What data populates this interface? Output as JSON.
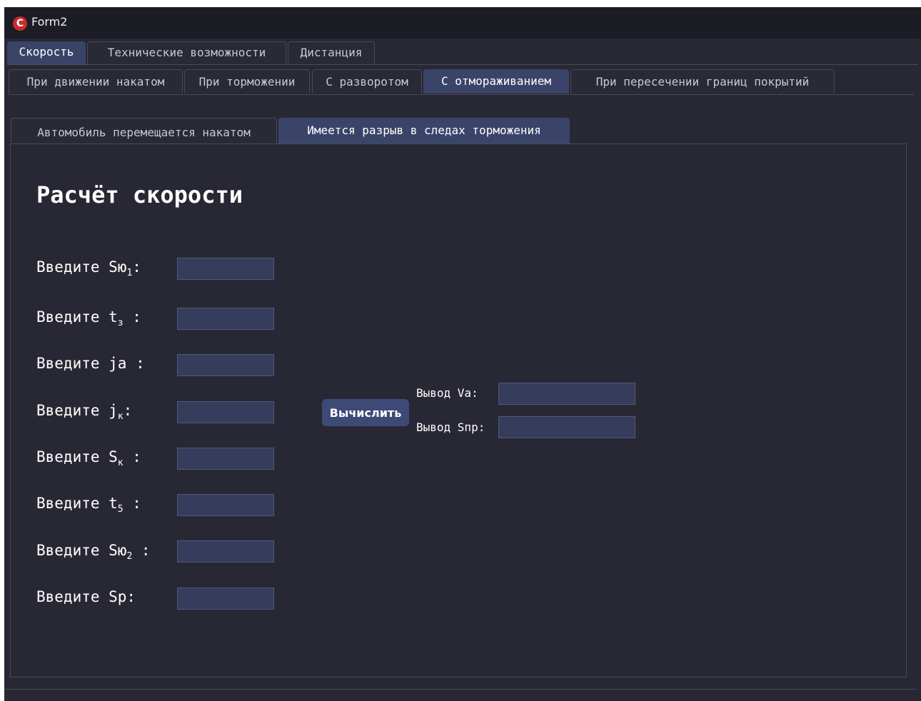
{
  "window": {
    "title": "Form2",
    "icon": "app-logo-icon"
  },
  "main_tabs": [
    {
      "label": "Скорость",
      "active": true
    },
    {
      "label": "Технические возможности",
      "active": false
    },
    {
      "label": "Дистанция",
      "active": false
    }
  ],
  "sub_tabs": [
    {
      "label": "При движении накатом",
      "active": false
    },
    {
      "label": "При торможении",
      "active": false
    },
    {
      "label": "С разворотом",
      "active": false
    },
    {
      "label": "С отмораживанием",
      "active": true
    },
    {
      "label": "При пересечении границ покрытий",
      "active": false
    }
  ],
  "inner_tabs": [
    {
      "label": "Автомобиль перемещается накатом",
      "active": false
    },
    {
      "label": "Имеется разрыв в следах торможения",
      "active": true
    }
  ],
  "content": {
    "heading": "Расчёт скорости",
    "fields": [
      {
        "prefix": "Введите Sю",
        "sub": "1",
        "suffix": ":",
        "value": ""
      },
      {
        "prefix": "Введите t",
        "sub": "з",
        "suffix": " :",
        "value": ""
      },
      {
        "prefix": "Введите jа",
        "sub": "",
        "suffix": " :",
        "value": ""
      },
      {
        "prefix": "Введите j",
        "sub": "к",
        "suffix": ":",
        "value": ""
      },
      {
        "prefix": "Введите S",
        "sub": "к",
        "suffix": " :",
        "value": ""
      },
      {
        "prefix": "Введите t",
        "sub": "5",
        "suffix": " :",
        "value": ""
      },
      {
        "prefix": "Введите Sю",
        "sub": "2",
        "suffix": " :",
        "value": ""
      },
      {
        "prefix": "Введите Sр:",
        "sub": "",
        "suffix": "",
        "value": ""
      }
    ],
    "calculate_label": "Вычислить",
    "outputs": [
      {
        "label": "Вывод Va:",
        "value": ""
      },
      {
        "label": "Вывод Sпр:",
        "value": ""
      }
    ]
  },
  "colors": {
    "background": "#282834",
    "titlebar": "#1c1c24",
    "active_tab": "#3a4468",
    "input_fill": "#363c5c",
    "button": "#3e4a76",
    "app_icon": "#cc2a2a"
  }
}
